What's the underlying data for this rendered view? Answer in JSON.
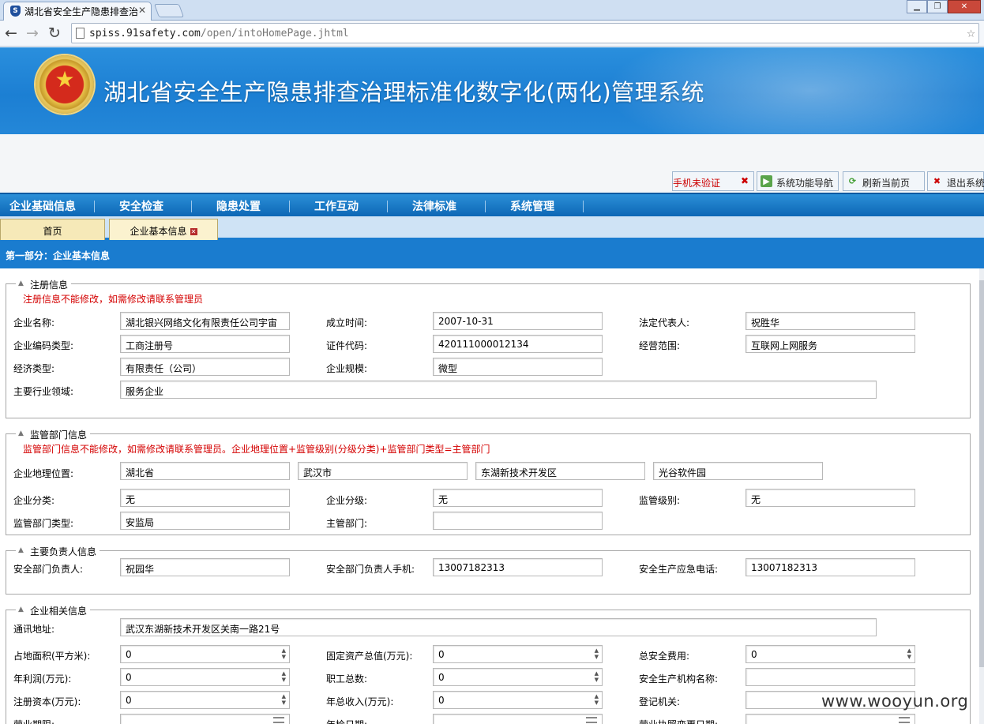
{
  "browser": {
    "tab_title": "湖北省安全生产隐患排查治",
    "favicon_letter": "S",
    "close_glyph": "✕",
    "url_host": "spiss.91safety.com",
    "url_path": "/open/intoHomePage.jhtml",
    "back_glyph": "←",
    "forward_glyph": "→",
    "reload_glyph": "↻",
    "bookmark_glyph": "☆",
    "min_glyph": "▁",
    "max_glyph": "❐",
    "win_close_glyph": "✕"
  },
  "header": {
    "system_title": "湖北省安全生产隐患排查治理标准化数字化(两化)管理系统",
    "emblem_star": "★"
  },
  "toolbar_buttons": [
    {
      "label": "手机未验证",
      "icon": "x-icon"
    },
    {
      "label": "系统功能导航",
      "icon": "navigation-icon"
    },
    {
      "label": "刷新当前页",
      "icon": "refresh-icon"
    },
    {
      "label": "退出系统",
      "icon": "exit-icon"
    }
  ],
  "menu": [
    "企业基础信息",
    "安全检查",
    "隐患处置",
    "工作互动",
    "法律标准",
    "系统管理"
  ],
  "page_tabs": [
    {
      "label": "首页"
    },
    {
      "label": "企业基本信息",
      "closable": true
    }
  ],
  "section_title": "第一部分：企业基本信息",
  "registration": {
    "legend": "注册信息",
    "notice": "注册信息不能修改，如需修改请联系管理员",
    "company_name_label": "企业名称:",
    "company_name": "湖北银兴网络文化有限责任公司宇宙",
    "established_label": "成立时间:",
    "established": "2007-10-31",
    "legal_rep_label": "法定代表人:",
    "legal_rep": "祝胜华",
    "code_type_label": "企业编码类型:",
    "code_type": "工商注册号",
    "cert_code_label": "证件代码:",
    "cert_code": "420111000012134",
    "scope_label": "经营范围:",
    "scope": "互联网上网服务",
    "econ_type_label": "经济类型:",
    "econ_type": "有限责任（公司）",
    "scale_label": "企业规模:",
    "scale": "微型",
    "industry_label": "主要行业领域:",
    "industry": "服务企业"
  },
  "supervision": {
    "legend": "监管部门信息",
    "notice": "监管部门信息不能修改，如需修改请联系管理员。企业地理位置+监管级别(分级分类)+监管部门类型=主管部门",
    "location_label": "企业地理位置:",
    "province": "湖北省",
    "city": "武汉市",
    "district": "东湖新技术开发区",
    "park": "光谷软件园",
    "category_label": "企业分类:",
    "category": "无",
    "grade_label": "企业分级:",
    "grade": "无",
    "level_label": "监管级别:",
    "level": "无",
    "dept_type_label": "监管部门类型:",
    "dept_type": "安监局",
    "competent_label": "主管部门:",
    "competent": ""
  },
  "responsible": {
    "legend": "主要负责人信息",
    "safety_head_label": "安全部门负责人:",
    "safety_head": "祝园华",
    "safety_phone_label": "安全部门负责人手机:",
    "safety_phone": "13007182313",
    "emergency_label": "安全生产应急电话:",
    "emergency": "13007182313"
  },
  "related": {
    "legend": "企业相关信息",
    "address_label": "通讯地址:",
    "address": "武汉东湖新技术开发区关南一路21号",
    "area_label": "占地面积(平方米):",
    "area": "0",
    "fixed_assets_label": "固定资产总值(万元):",
    "fixed_assets": "0",
    "safety_cost_label": "总安全费用:",
    "safety_cost": "0",
    "profit_label": "年利润(万元):",
    "profit": "0",
    "employees_label": "职工总数:",
    "employees": "0",
    "safety_org_label": "安全生产机构名称:",
    "safety_org": "",
    "capital_label": "注册资本(万元):",
    "capital": "0",
    "revenue_label": "年总收入(万元):",
    "revenue": "0",
    "reg_authority_label": "登记机关:",
    "reg_authority": "",
    "biz_term_label": "营业期限:",
    "annual_check_label": "年检日期:",
    "license_change_label": "营业执照变更日期:"
  },
  "watermark": "www.wooyun.org"
}
